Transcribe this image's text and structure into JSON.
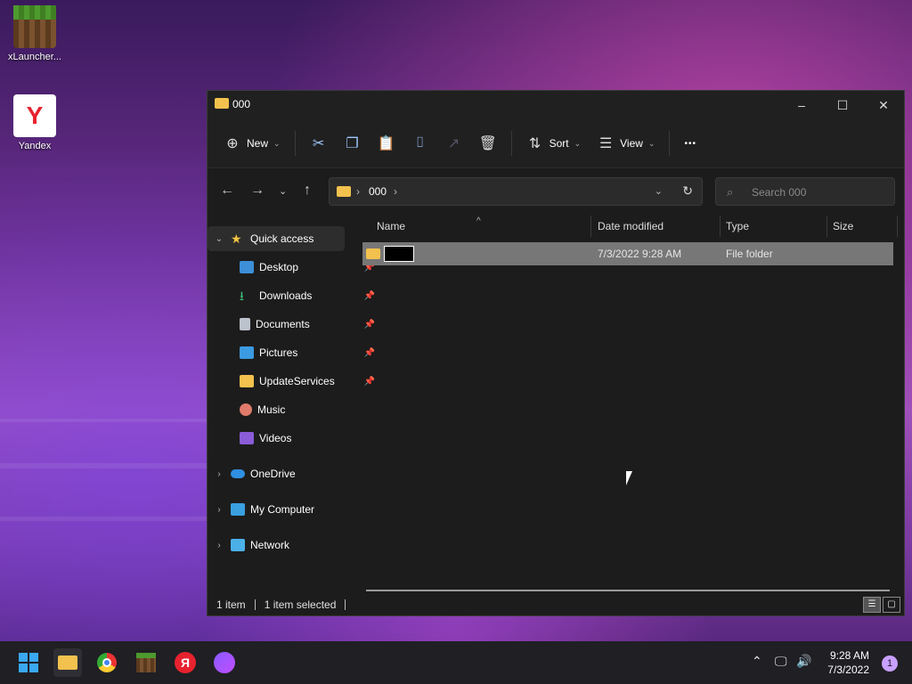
{
  "desktop": {
    "icons": [
      {
        "label": "xLauncher...",
        "icon": "minecraft-launcher-icon"
      },
      {
        "label": "Yandex",
        "icon": "yandex-browser-icon"
      }
    ]
  },
  "window": {
    "title": "000",
    "controls": {
      "minimize": "–",
      "maximize": "☐",
      "close": "✕"
    }
  },
  "toolbar": {
    "new_label": "New",
    "sort_label": "Sort",
    "view_label": "View",
    "more_label": "•••"
  },
  "address": {
    "crumbs": [
      "000"
    ],
    "search_placeholder": "Search 000"
  },
  "nav": {
    "quick_access": "Quick access",
    "items": [
      {
        "label": "Desktop",
        "pinned": true,
        "icon": "desktop-icon"
      },
      {
        "label": "Downloads",
        "pinned": true,
        "icon": "downloads-icon"
      },
      {
        "label": "Documents",
        "pinned": true,
        "icon": "documents-icon"
      },
      {
        "label": "Pictures",
        "pinned": true,
        "icon": "pictures-icon"
      },
      {
        "label": "UpdateServices",
        "pinned": true,
        "icon": "folder-icon"
      },
      {
        "label": "Music",
        "pinned": false,
        "icon": "music-icon"
      },
      {
        "label": "Videos",
        "pinned": false,
        "icon": "videos-icon"
      }
    ],
    "roots": [
      {
        "label": "OneDrive",
        "icon": "onedrive-icon"
      },
      {
        "label": "My Computer",
        "icon": "computer-icon"
      },
      {
        "label": "Network",
        "icon": "network-icon"
      }
    ]
  },
  "list": {
    "columns": [
      "Name",
      "Date modified",
      "Type",
      "Size"
    ],
    "rows": [
      {
        "name": "",
        "date": "7/3/2022 9:28 AM",
        "type": "File folder",
        "size": "",
        "renaming": true
      }
    ]
  },
  "status": {
    "count": "1 item",
    "selected": "1 item selected"
  },
  "taskbar": {
    "apps": [
      "start-icon",
      "file-explorer-icon",
      "chrome-icon",
      "minecraft-launcher-icon",
      "yandex-browser-icon",
      "alice-icon"
    ],
    "time": "9:28 AM",
    "date": "7/3/2022",
    "notifications": "1"
  }
}
